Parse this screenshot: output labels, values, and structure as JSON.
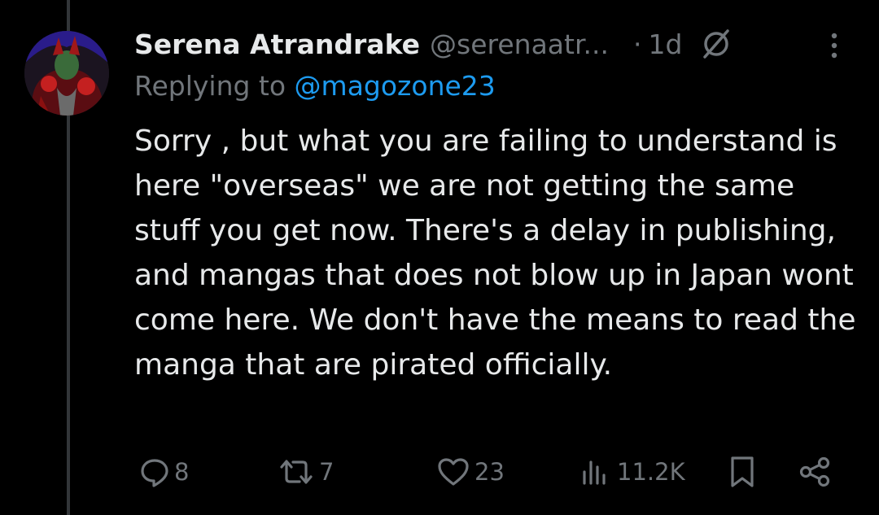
{
  "tweet": {
    "author_name": "Serena Atrandrake",
    "author_handle": "@serenaatr...",
    "separator": "·",
    "timestamp": "1d",
    "reply_prefix": "Replying to ",
    "reply_handle": "@magozone23",
    "text": "Sorry , but what you are failing to understand is here \"overseas\" we are not getting the same stuff you get now. There's a delay in publishing, and mangas that does not blow up in Japan wont come here. We don't have the means to read the manga that are pirated officially."
  },
  "actions": {
    "replies": "8",
    "reposts": "7",
    "likes": "23",
    "views": "11.2K"
  },
  "icons": {
    "grok": "grok-slash-icon",
    "more": "more-vertical-icon",
    "reply": "comment-icon",
    "repost": "repost-icon",
    "like": "heart-icon",
    "views": "analytics-icon",
    "bookmark": "bookmark-icon",
    "share": "share-icon"
  },
  "colors": {
    "background": "#000000",
    "text": "#e7e9ea",
    "secondary": "#71767b",
    "link": "#1d9bf0"
  }
}
